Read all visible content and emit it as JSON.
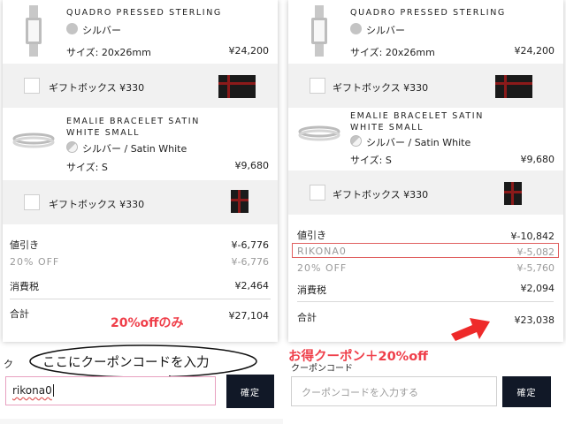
{
  "left": {
    "product1": {
      "name": "QUADRO PRESSED STERLING",
      "color": "シルバー",
      "size": "サイズ: 20x26mm",
      "price": "¥24,200"
    },
    "gift1": {
      "label": "ギフトボックス ¥330"
    },
    "product2": {
      "name_line1": "EMALIE BRACELET SATIN",
      "name_line2": "WHITE SMALL",
      "color": "シルバー / Satin White",
      "size": "サイズ: S",
      "price": "¥9,680"
    },
    "gift2": {
      "label": "ギフトボックス ¥330"
    },
    "summary": {
      "discount_label": "値引き",
      "discount_value": "¥-6,776",
      "off_label": "20% OFF",
      "off_value": "¥-6,776",
      "tax_label": "消費税",
      "tax_value": "¥2,464",
      "total_label": "合計",
      "total_value": "¥27,104"
    },
    "annotation": "20%offのみ",
    "coupon_label": "ク",
    "speech_bubble": "ここにクーポンコードを入力",
    "coupon_value": "rikona0",
    "confirm_label": "確定"
  },
  "right": {
    "product1": {
      "name": "QUADRO PRESSED STERLING",
      "color": "シルバー",
      "size": "サイズ: 20x26mm",
      "price": "¥24,200"
    },
    "gift1": {
      "label": "ギフトボックス ¥330"
    },
    "product2": {
      "name_line1": "EMALIE BRACELET SATIN",
      "name_line2": "WHITE SMALL",
      "color": "シルバー / Satin White",
      "size": "サイズ: S",
      "price": "¥9,680"
    },
    "gift2": {
      "label": "ギフトボックス ¥330"
    },
    "summary": {
      "discount_label": "値引き",
      "discount_value": "¥-10,842",
      "coupon_label": "RIKONA0",
      "coupon_value": "¥-5,082",
      "off_label": "20% OFF",
      "off_value": "¥-5,760",
      "tax_label": "消費税",
      "tax_value": "¥2,094",
      "total_label": "合計",
      "total_value": "¥23,038"
    },
    "annotation": "お得クーポン＋20%off",
    "coupon_label": "クーポンコード",
    "coupon_placeholder": "クーポンコードを入力する",
    "confirm_label": "確定"
  },
  "colors": {
    "annotation_red": "#ef3f4a",
    "button_dark": "#111827",
    "coupon_highlight": "#e06060",
    "input_pink": "#e8a0c0"
  },
  "icons": {
    "watch": "watch-icon",
    "bracelet": "bracelet-icon",
    "giftbox": "gift-box-icon",
    "arrow": "red-arrow-icon"
  }
}
